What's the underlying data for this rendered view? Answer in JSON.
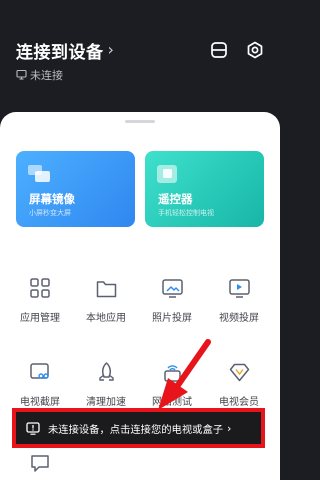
{
  "header": {
    "title": "连接到设备",
    "status": "未连接"
  },
  "cards": [
    {
      "title": "屏幕镜像",
      "subtitle": "小屏秒变大屏"
    },
    {
      "title": "遥控器",
      "subtitle": "手机轻松控制电视"
    }
  ],
  "grid": {
    "row1": [
      "应用管理",
      "本地应用",
      "照片投屏",
      "视频投屏"
    ],
    "row2": [
      "电视截屏",
      "清理加速",
      "网络测试",
      "电视会员"
    ]
  },
  "toast": {
    "text": "未连接设备，点击连接您的电视或盒子"
  },
  "colors": {
    "background": "#1c1d22",
    "mirror_card": "#3a9af6",
    "remote_card": "#25c9b9",
    "highlight_border": "#e8141b",
    "arrow": "#e8141b"
  }
}
